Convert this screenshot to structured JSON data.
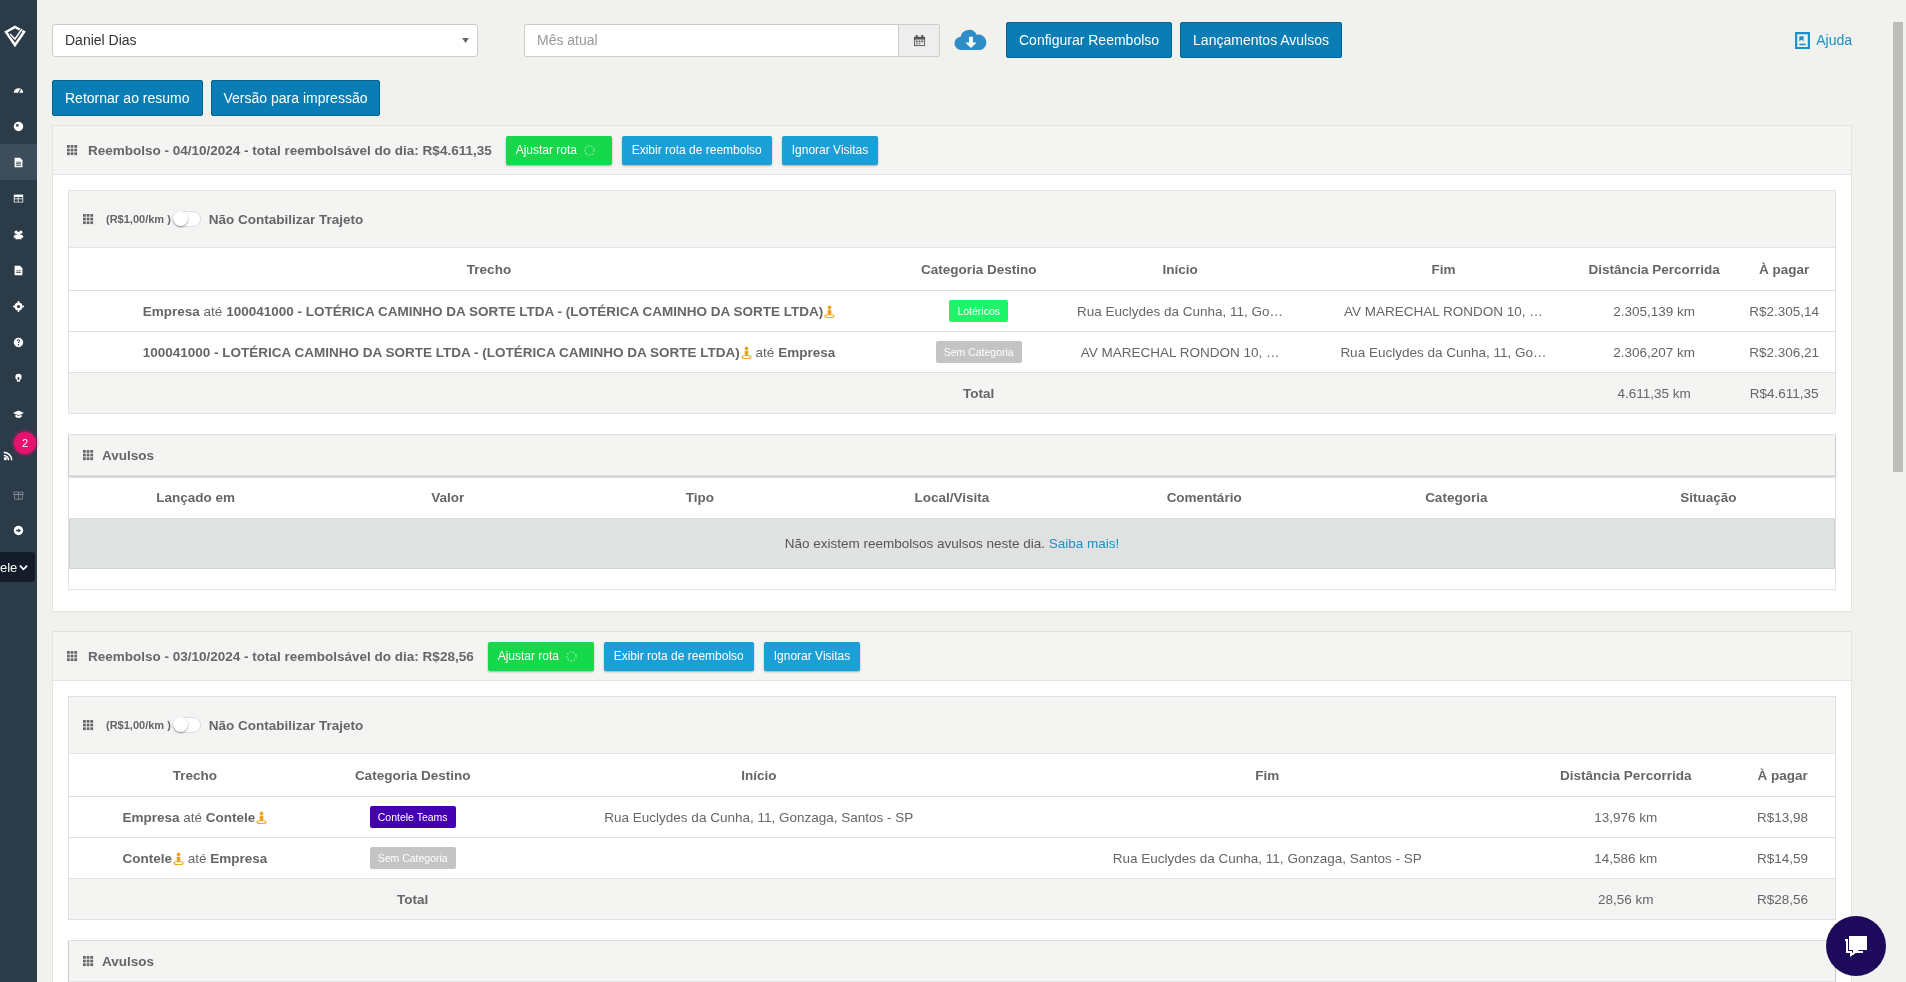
{
  "sidebar": {
    "items": [
      {
        "selected": false
      },
      {
        "selected": false
      },
      {
        "selected": true
      },
      {
        "selected": false
      },
      {
        "selected": false
      },
      {
        "selected": false
      },
      {
        "selected": false
      },
      {
        "selected": false
      },
      {
        "selected": false
      },
      {
        "selected": false
      },
      {
        "selected": false,
        "badge": "2"
      },
      {
        "selected": false
      },
      {
        "selected": false
      }
    ],
    "select": {
      "value": "ele"
    }
  },
  "toolbar": {
    "user_select": {
      "value": "Daniel Dias"
    },
    "month_field": {
      "placeholder": "Mês atual"
    },
    "buttons": [
      "Configurar Reembolso",
      "Lançamentos Avulsos"
    ],
    "help_link": "Ajuda"
  },
  "actions": [
    "Retornar ao resumo",
    "Versão para impressão"
  ],
  "days": [
    {
      "title": "Reembolso - 04/10/2024 - total reembolsável do dia: R$4.611,35",
      "buttons": [
        {
          "kind": "adjust",
          "label": "Ajustar rota"
        },
        {
          "kind": "route",
          "label": "Exibir rota de reembolso"
        },
        {
          "kind": "ignore",
          "label": "Ignorar Visitas"
        }
      ],
      "trips": {
        "rate": "(R$1,00/km )",
        "toggle": {
          "on": false,
          "label": "Não Contabilizar Trajeto"
        },
        "columns": [
          "Trecho",
          "Categoria Destino",
          "Início",
          "Fim",
          "Distância Percorrida",
          "À pagar"
        ],
        "rows": [
          {
            "trecho": [
              {
                "text": "Empresa",
                "bold": true,
                "pin": false
              },
              {
                "text": "até",
                "bold": false,
                "pin": false
              },
              {
                "text": "100041000 - LOTÉRICA CAMINHO DA SORTE LTDA - (LOTÉRICA CAMINHO DA SORTE LTDA)",
                "bold": true,
                "pin": true
              }
            ],
            "category": {
              "label": "Lotéricos",
              "color": "#1ef46a"
            },
            "start": "Rua Euclydes da Cunha, 11, Go…",
            "end": "AV MARECHAL RONDON 10, …",
            "distance": "2.305,139 km",
            "pay": "R$2.305,14"
          },
          {
            "trecho": [
              {
                "text": "100041000 - LOTÉRICA CAMINHO DA SORTE LTDA - (LOTÉRICA CAMINHO DA SORTE LTDA)",
                "bold": true,
                "pin": true
              },
              {
                "text": "até",
                "bold": false,
                "pin": false
              },
              {
                "text": "Empresa",
                "bold": true,
                "pin": false
              }
            ],
            "category": {
              "label": "Sem Categoria",
              "color": "#c4c4c4"
            },
            "start": "AV MARECHAL RONDON 10, …",
            "end": "Rua Euclydes da Cunha, 11, Go…",
            "distance": "2.306,207 km",
            "pay": "R$2.306,21"
          }
        ],
        "total": {
          "label": "Total",
          "distance": "4.611,35 km",
          "pay": "R$4.611,35"
        }
      },
      "extras": {
        "title": "Avulsos",
        "columns": [
          "Lançado em",
          "Valor",
          "Tipo",
          "Local/Visita",
          "Comentário",
          "Categoria",
          "Situação"
        ],
        "empty": {
          "text": "Não existem reembolsos avulsos neste dia.",
          "link": "Saiba mais!"
        }
      }
    },
    {
      "title": "Reembolso - 03/10/2024 - total reembolsável do dia: R$28,56",
      "buttons": [
        {
          "kind": "adjust",
          "label": "Ajustar rota"
        },
        {
          "kind": "route",
          "label": "Exibir rota de reembolso"
        },
        {
          "kind": "ignore",
          "label": "Ignorar Visitas"
        }
      ],
      "trips": {
        "rate": "(R$1,00/km )",
        "toggle": {
          "on": false,
          "label": "Não Contabilizar Trajeto"
        },
        "columns": [
          "Trecho",
          "Categoria Destino",
          "Início",
          "Fim",
          "Distância Percorrida",
          "À pagar"
        ],
        "rows": [
          {
            "trecho": [
              {
                "text": "Empresa",
                "bold": true,
                "pin": false
              },
              {
                "text": "até",
                "bold": false,
                "pin": false
              },
              {
                "text": "Contele",
                "bold": true,
                "pin": true
              }
            ],
            "category": {
              "label": "Contele Teams",
              "color": "#4400b0"
            },
            "start": "Rua Euclydes da Cunha, 11, Gonzaga, Santos - SP",
            "distance": "13,976 km",
            "pay": "R$13,98"
          },
          {
            "trecho": [
              {
                "text": "Contele",
                "bold": true,
                "pin": true
              },
              {
                "text": "até",
                "bold": false,
                "pin": false
              },
              {
                "text": "Empresa",
                "bold": true,
                "pin": false
              }
            ],
            "category": {
              "label": "Sem Categoria",
              "color": "#c4c4c4"
            },
            "end": "Rua Euclydes da Cunha, 11, Gonzaga, Santos - SP",
            "distance": "14,586 km",
            "pay": "R$14,59"
          }
        ],
        "total": {
          "label": "Total",
          "distance": "28,56 km",
          "pay": "R$28,56"
        }
      },
      "extras": {
        "title": "Avulsos"
      }
    }
  ]
}
